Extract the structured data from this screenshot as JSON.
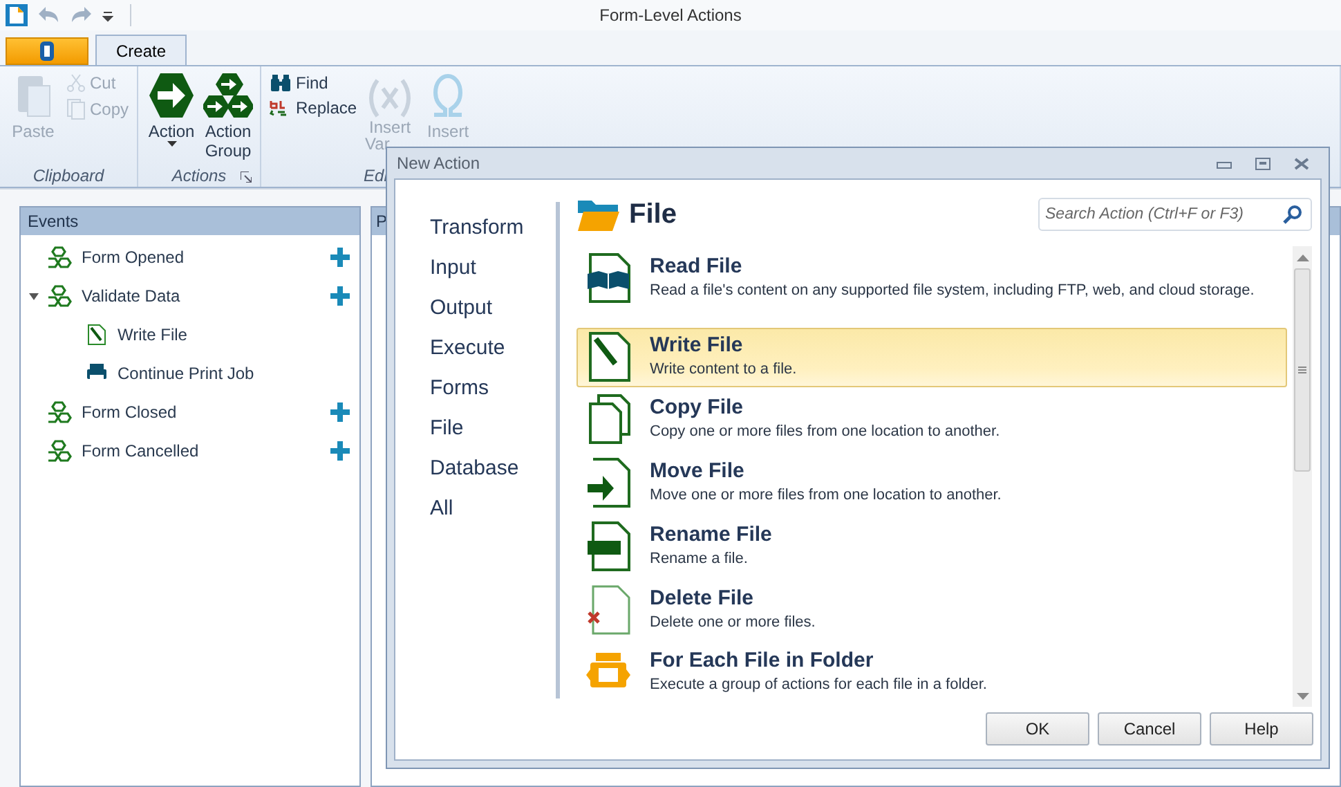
{
  "window": {
    "title": "Form-Level Actions"
  },
  "ribbon": {
    "tabs": [
      {
        "label": "Create",
        "selected": true
      }
    ],
    "groups": [
      {
        "label": "Clipboard",
        "buttons": [
          {
            "label": "Paste",
            "kind": "large",
            "disabled": true
          },
          {
            "label": "Cut",
            "kind": "small",
            "disabled": true
          },
          {
            "label": "Copy",
            "kind": "small",
            "disabled": true
          }
        ]
      },
      {
        "label": "Actions",
        "launcher": true,
        "buttons": [
          {
            "label": "Action",
            "kind": "large",
            "disabled": false,
            "dropdown": true
          },
          {
            "label": "Action Group",
            "kind": "large",
            "disabled": false
          }
        ]
      },
      {
        "label": "Edi",
        "buttons": [
          {
            "label": "Find",
            "kind": "small",
            "disabled": false
          },
          {
            "label": "Replace",
            "kind": "small",
            "disabled": false
          },
          {
            "label": "Insert",
            "sublabel": "Var",
            "kind": "large",
            "disabled": true
          },
          {
            "label": "Insert",
            "kind": "large",
            "disabled": true
          }
        ]
      }
    ]
  },
  "events": {
    "header": "Events",
    "items": [
      {
        "label": "Form Opened",
        "addable": true
      },
      {
        "label": "Validate Data",
        "addable": true,
        "expanded": true,
        "children": [
          {
            "label": "Write File",
            "addable": false
          },
          {
            "label": "Continue Print Job",
            "addable": false
          }
        ]
      },
      {
        "label": "Form Closed",
        "addable": true
      },
      {
        "label": "Form Cancelled",
        "addable": true
      }
    ]
  },
  "panel_2": {
    "header": "P"
  },
  "dialog": {
    "title": "New Action",
    "categories": [
      "Transform",
      "Input",
      "Output",
      "Execute",
      "Forms",
      "File",
      "Database",
      "All"
    ],
    "heading": "File",
    "search": {
      "placeholder": "Search Action (Ctrl+F or F3)"
    },
    "actions": [
      {
        "title": "Read File",
        "description": "Read a file's content on any supported file system, including FTP, web, and cloud storage.",
        "selected": false
      },
      {
        "title": "Write File",
        "description": "Write content to a file.",
        "selected": true
      },
      {
        "title": "Copy File",
        "description": "Copy one or more files from one location to another.",
        "selected": false
      },
      {
        "title": "Move File",
        "description": "Move one or more files from one location to another.",
        "selected": false
      },
      {
        "title": "Rename File",
        "description": "Rename a file.",
        "selected": false
      },
      {
        "title": "Delete File",
        "description": "Delete one or more files.",
        "selected": false
      },
      {
        "title": "For Each File in Folder",
        "description": "Execute a group of actions for each file in a folder.",
        "selected": false
      }
    ],
    "buttons": [
      "OK",
      "Cancel",
      "Help"
    ]
  }
}
